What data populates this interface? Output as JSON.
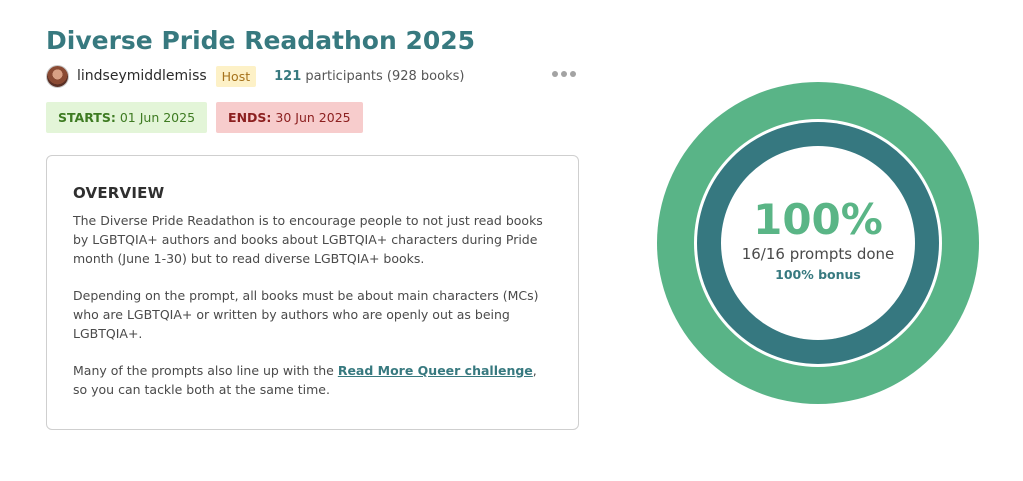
{
  "challenge": {
    "title": "Diverse Pride Readathon 2025"
  },
  "host": {
    "username": "lindseymiddlemiss",
    "badge": "Host"
  },
  "stats": {
    "participants_count": "121",
    "participants_text": "participants (928 books)"
  },
  "dates": {
    "start_label": "STARTS:",
    "start_value": "01 Jun 2025",
    "end_label": "ENDS:",
    "end_value": "30 Jun 2025"
  },
  "overview": {
    "heading": "OVERVIEW",
    "paragraph1": "The Diverse Pride Readathon is to encourage people to not just read books by LGBTQIA+ authors and books about LGBTQIA+ characters during Pride month (June 1-30) but to read diverse LGBTQIA+ books.",
    "paragraph2": "Depending on the prompt, all books must be about main characters (MCs) who are LGBTQIA+ or written by authors who are openly out as being LGBTQIA+.",
    "paragraph3_before": "Many of the prompts also line up with the ",
    "paragraph3_link": "Read More Queer challenge",
    "paragraph3_after": ", so you can tackle both at the same time."
  },
  "progress": {
    "percent_label": "100%",
    "prompts_done": "16/16 prompts done",
    "bonus": "100% bonus",
    "fraction": 1.0
  },
  "colors": {
    "accent_teal": "#37797f",
    "ring_outer": "#59b487",
    "ring_inner": "#367880",
    "start_bg": "#e3f5d8",
    "end_bg": "#f7cccc"
  },
  "icons": {
    "more": "more-horizontal-icon",
    "avatar": "avatar-photo"
  }
}
